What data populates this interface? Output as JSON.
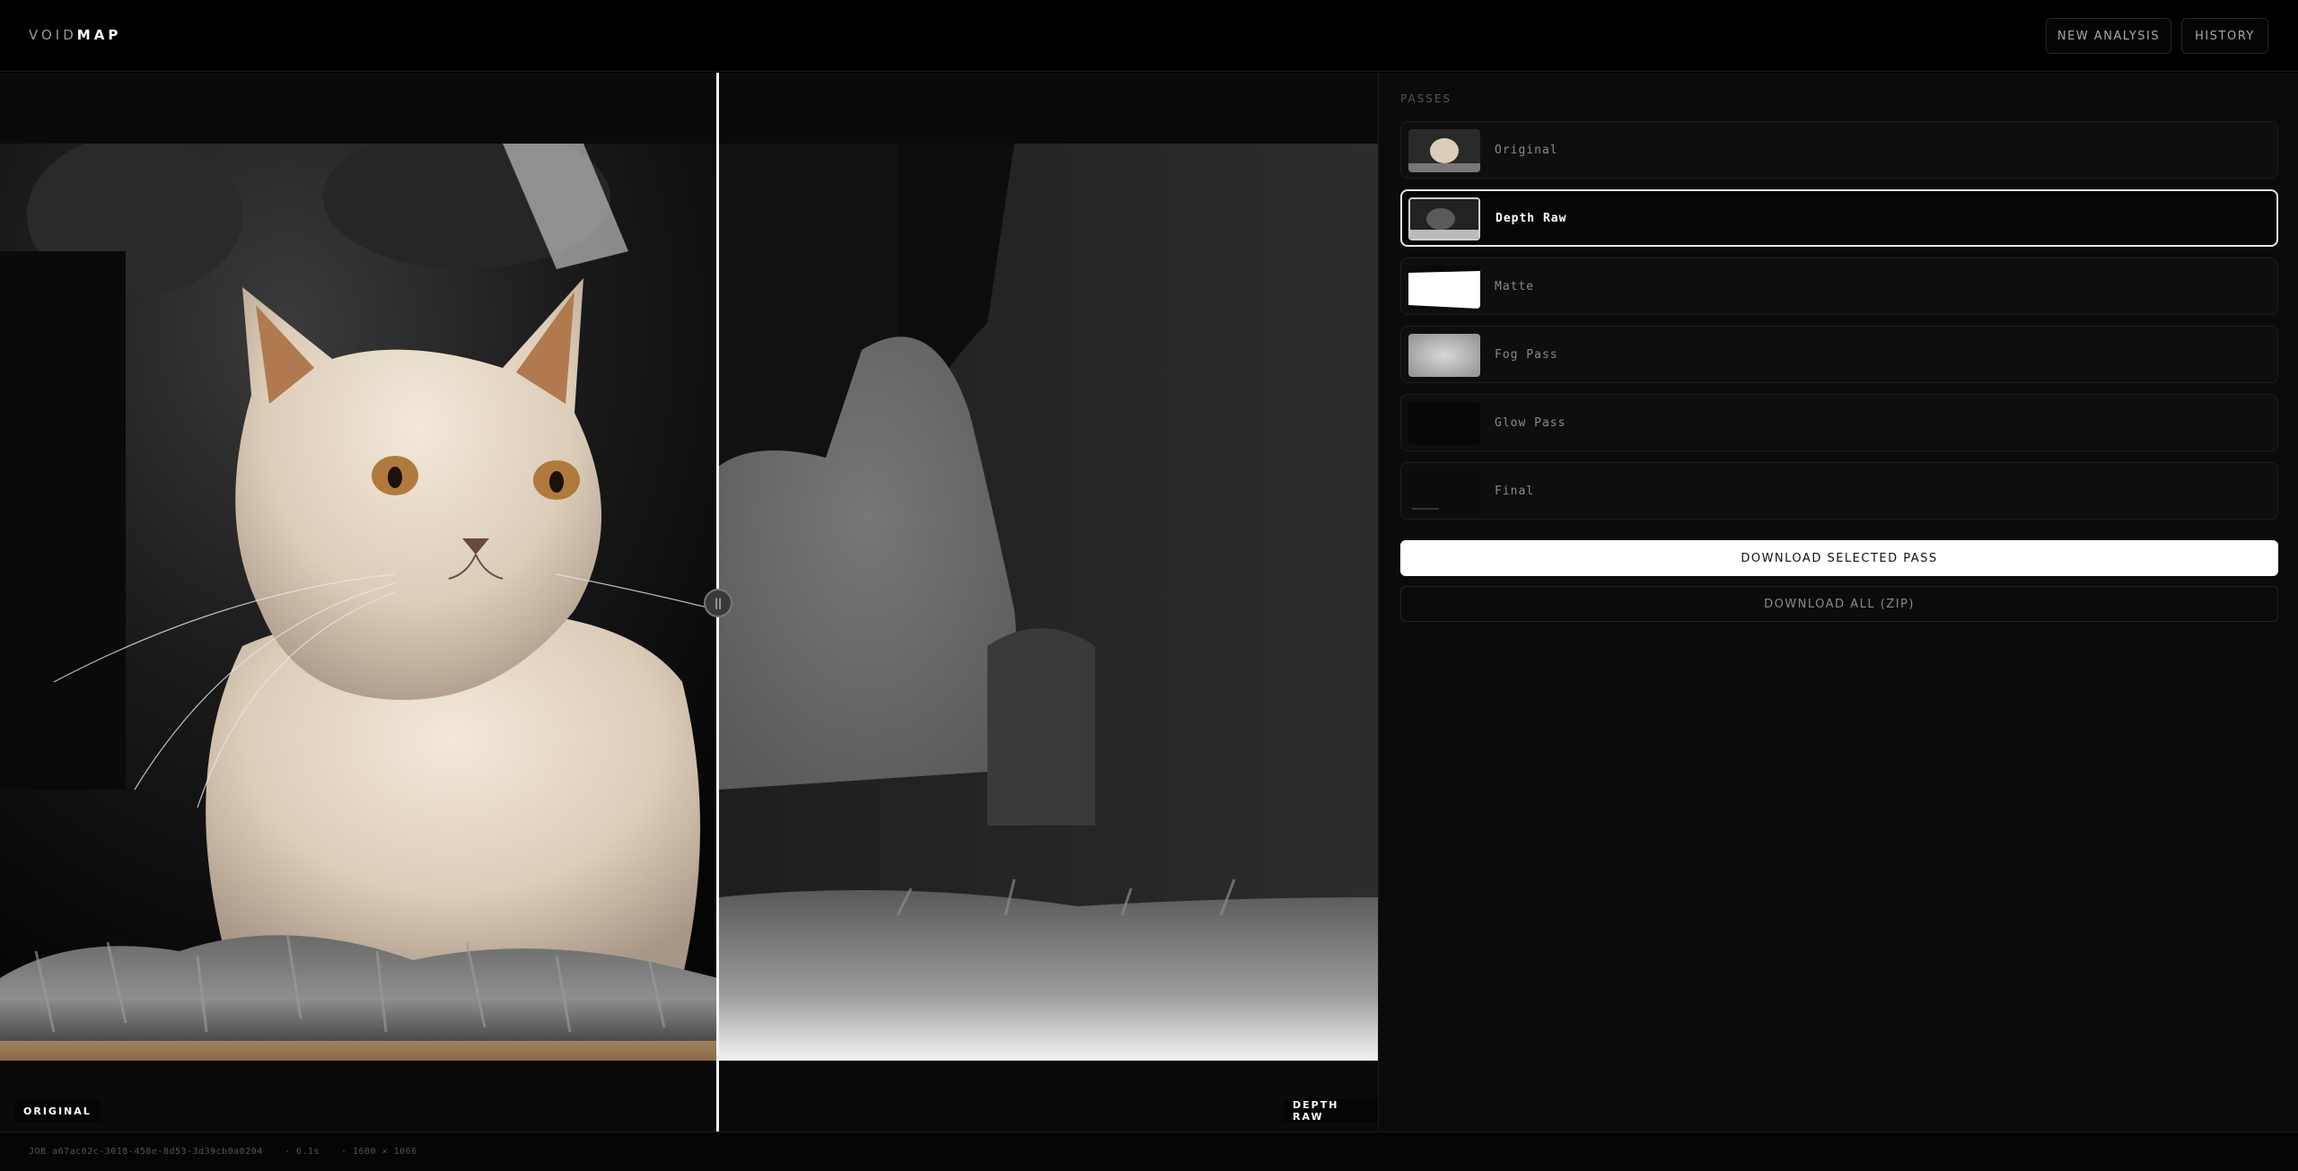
{
  "header": {
    "logo_light": "VOID",
    "logo_bold": "MAP",
    "new_analysis_label": "NEW ANALYSIS",
    "history_label": "HISTORY"
  },
  "viewer": {
    "left_tag": "ORIGINAL",
    "right_tag": "DEPTH RAW",
    "split_position": 0.52,
    "handle_glyph": "||"
  },
  "panel": {
    "title": "PASSES",
    "passes": [
      {
        "label": "Original",
        "selected": false
      },
      {
        "label": "Depth Raw",
        "selected": true
      },
      {
        "label": "Matte",
        "selected": false
      },
      {
        "label": "Fog Pass",
        "selected": false
      },
      {
        "label": "Glow Pass",
        "selected": false
      },
      {
        "label": "Final",
        "selected": false
      }
    ],
    "download_selected_label": "DOWNLOAD SELECTED PASS",
    "download_all_label": "DOWNLOAD ALL (ZIP)"
  },
  "footer": {
    "job": "JOB a67ac02c-3018-458e-8d53-3d39cb0a0204",
    "time": "· 6.1s",
    "dims": "· 1600 × 1066"
  },
  "colors": {
    "background": "#000000",
    "panel": "#0b0b0b",
    "accent": "#ffffff"
  }
}
